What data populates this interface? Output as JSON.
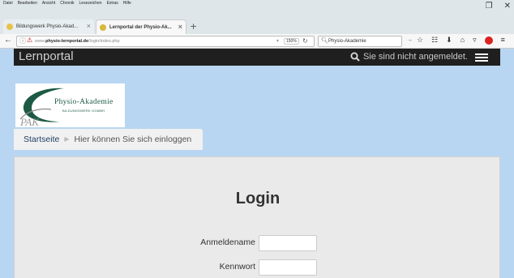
{
  "browser": {
    "menu": [
      "Datei",
      "Bearbeiten",
      "Ansicht",
      "Chronik",
      "Lesezeichen",
      "Extras",
      "Hilfe"
    ],
    "tabs": [
      {
        "label": "Bildungswerk Physio-Akad..."
      },
      {
        "label": "Lernportal der Physio-Ak..."
      }
    ],
    "url_prefix": "www.",
    "url_domain": "physio-lernportal.de",
    "url_path": "/login/index.php",
    "zoom": "150%",
    "search_value": "Physio-Akademie",
    "colors": {
      "tab1_favicon": "#e8c34a",
      "tab2_favicon": "#d9b73b",
      "adblock": "#dd2222"
    }
  },
  "site": {
    "brand": "Lernportal",
    "login_status": "Sie sind nicht angemeldet.",
    "logo_name": "Physio-Akademie",
    "logo_sub": "BILDUNGSWERK GGMBH",
    "breadcrumb": {
      "home": "Startseite",
      "current": "Hier können Sie sich einloggen"
    },
    "login": {
      "heading": "Login",
      "username_label": "Anmeldename",
      "username_value": "",
      "password_label": "Kennwort",
      "password_value": ""
    },
    "colors": {
      "background": "#b8d6f2",
      "header": "#1f1f1f",
      "logo_green": "#1d5a44"
    }
  }
}
